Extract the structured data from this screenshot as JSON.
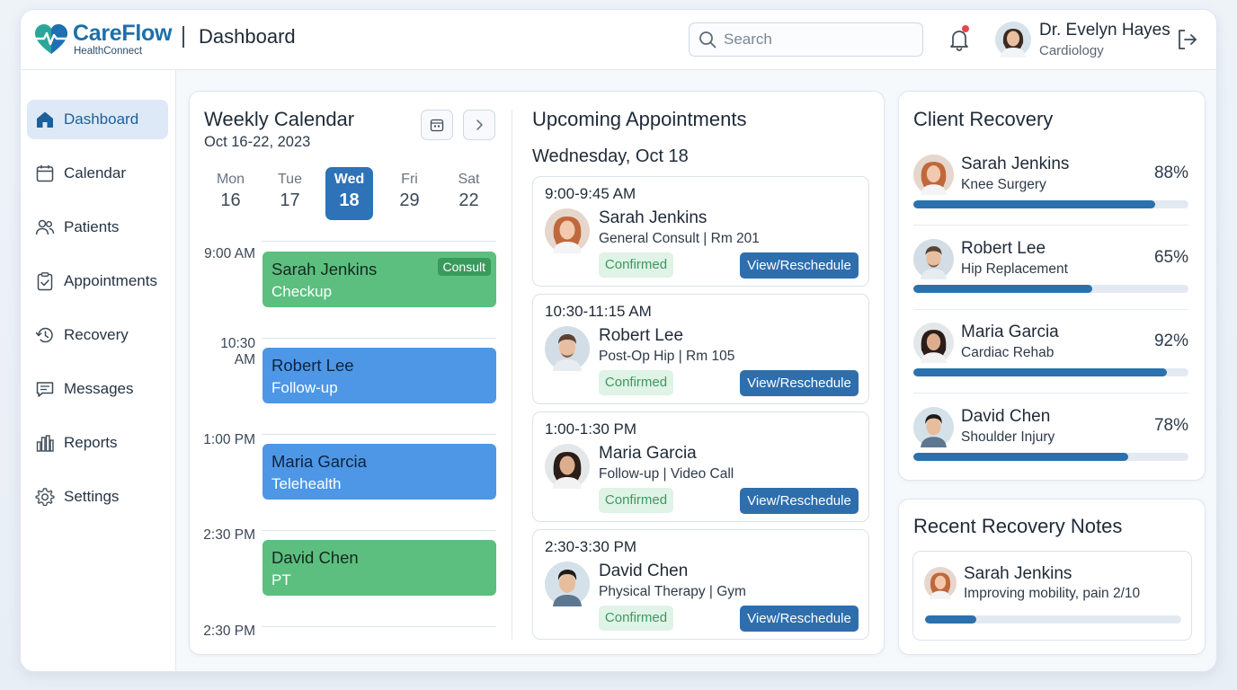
{
  "app": {
    "brand_name": "CareFlow",
    "brand_sub": "HealthConnect",
    "page_title": "Dashboard"
  },
  "header": {
    "search_placeholder": "Search",
    "user_name": "Dr. Evelyn Hayes",
    "user_role": "Cardiology",
    "icons": [
      "search-icon",
      "bell-icon",
      "logout-icon"
    ],
    "notification_dot_color": "#e5484d"
  },
  "sidebar": {
    "items": [
      {
        "label": "Dashboard",
        "icon": "home-icon",
        "active": true
      },
      {
        "label": "Calendar",
        "icon": "calendar-icon",
        "active": false
      },
      {
        "label": "Patients",
        "icon": "patients-icon",
        "active": false
      },
      {
        "label": "Appointments",
        "icon": "clipboard-check-icon",
        "active": false
      },
      {
        "label": "Recovery",
        "icon": "history-icon",
        "active": false
      },
      {
        "label": "Messages",
        "icon": "message-icon",
        "active": false
      },
      {
        "label": "Reports",
        "icon": "bar-chart-icon",
        "active": false
      },
      {
        "label": "Settings",
        "icon": "gear-icon",
        "active": false
      }
    ]
  },
  "calendar": {
    "title": "Weekly Calendar",
    "range": "Oct 16-22, 2023",
    "days": [
      {
        "name": "Mon",
        "num": "16"
      },
      {
        "name": "Tue",
        "num": "17"
      },
      {
        "name": "Wed",
        "num": "18",
        "active": true
      },
      {
        "name": "Fri",
        "num": "29"
      },
      {
        "name": "Sat",
        "num": "22"
      }
    ],
    "times": [
      "9:00 AM",
      "10:30 AM",
      "1:00 PM",
      "2:30 PM",
      "2:30 PM"
    ],
    "events": [
      {
        "name": "Sarah Jenkins",
        "type": "Checkup",
        "badge": "Consult",
        "color": "green"
      },
      {
        "name": "Robert Lee",
        "type": "Follow-up",
        "color": "blue"
      },
      {
        "name": "Maria Garcia",
        "type": "Telehealth",
        "color": "blue"
      },
      {
        "name": "David Chen",
        "type": "PT",
        "color": "green"
      }
    ]
  },
  "appointments": {
    "title": "Upcoming Appointments",
    "date": "Wednesday, Oct 18",
    "items": [
      {
        "time": "9:00-9:45 AM",
        "name": "Sarah Jenkins",
        "detail": "General Consult | Rm 201",
        "status": "Confirmed",
        "action": "View/Reschedule"
      },
      {
        "time": "10:30-11:15 AM",
        "name": "Robert Lee",
        "detail": "Post-Op Hip | Rm 105",
        "status": "Confirmed",
        "action": "View/Reschedule"
      },
      {
        "time": "1:00-1:30 PM",
        "name": "Maria Garcia",
        "detail": "Follow-up | Video Call",
        "status": "Confirmed",
        "action": "View/Reschedule"
      },
      {
        "time": "2:30-3:30 PM",
        "name": "David Chen",
        "detail": "Physical Therapy | Gym",
        "status": "Confirmed",
        "action": "View/Reschedule"
      }
    ]
  },
  "recovery": {
    "title": "Client Recovery",
    "items": [
      {
        "name": "Sarah Jenkins",
        "condition": "Knee Surgery",
        "percent": "88%",
        "value": 0.88
      },
      {
        "name": "Robert Lee",
        "condition": "Hip Replacement",
        "percent": "65%",
        "value": 0.65
      },
      {
        "name": "Maria Garcia",
        "condition": "Cardiac Rehab",
        "percent": "92%",
        "value": 0.92
      },
      {
        "name": "David Chen",
        "condition": "Shoulder Injury",
        "percent": "78%",
        "value": 0.78
      }
    ]
  },
  "notes": {
    "title": "Recent Recovery Notes",
    "items": [
      {
        "name": "Sarah Jenkins",
        "text": "Improving mobility, pain 2/10",
        "progress": 0.2
      }
    ]
  },
  "colors": {
    "primary": "#2e72b8",
    "green_event": "#5cbf7f",
    "blue_event": "#4d97e6",
    "confirmed_bg": "#dff3e6",
    "progress": "#2b71ad"
  }
}
